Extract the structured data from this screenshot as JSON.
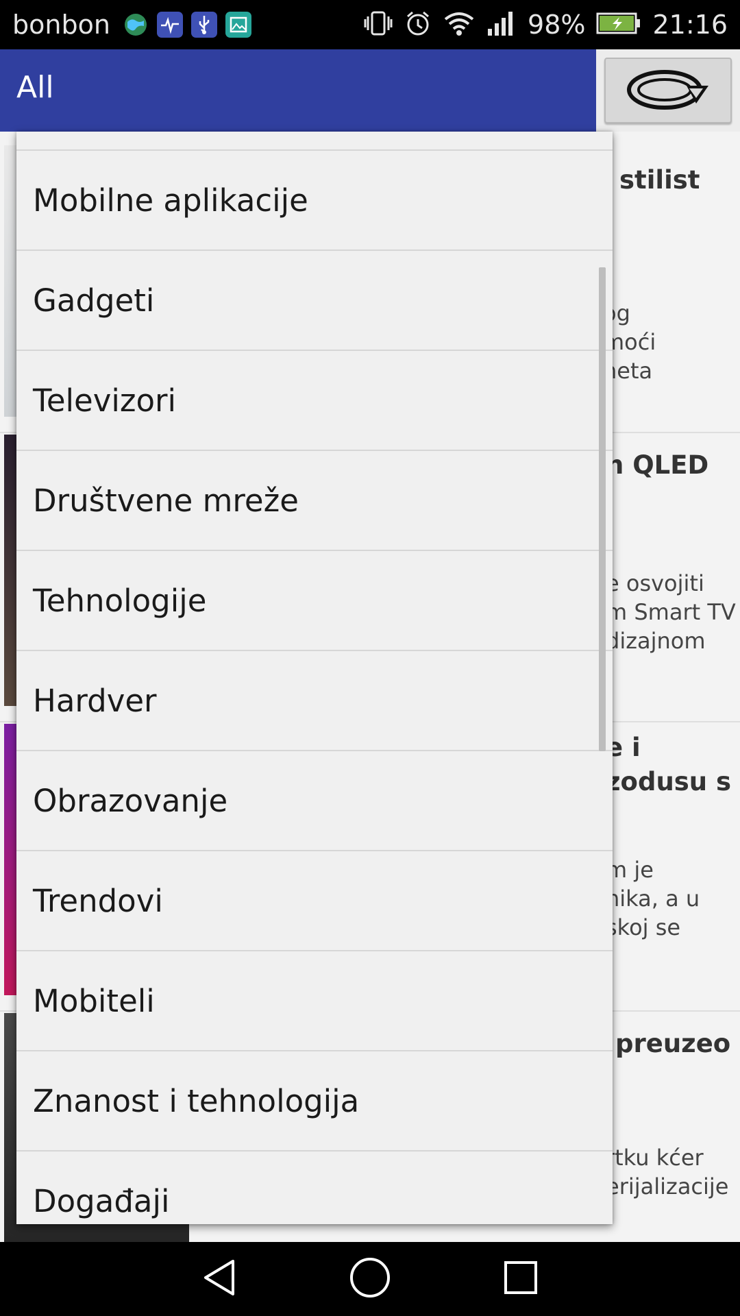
{
  "status_bar": {
    "carrier": "bonbon",
    "notification_icons": [
      "globe-icon",
      "health-icon",
      "usb-icon",
      "gallery-icon"
    ],
    "system_icons": [
      "vibrate-icon",
      "alarm-icon",
      "wifi-icon",
      "signal-icon"
    ],
    "battery_percent": "98%",
    "time": "21:16"
  },
  "app_bar": {
    "title": "All",
    "refresh_icon": "refresh-icon"
  },
  "dropdown": {
    "items": [
      {
        "label": "Mobilne aplikacije"
      },
      {
        "label": "Gadgeti"
      },
      {
        "label": "Televizori"
      },
      {
        "label": "Društvene mreže"
      },
      {
        "label": "Tehnologije"
      },
      {
        "label": "Hardver"
      },
      {
        "label": "Obrazovanje"
      },
      {
        "label": "Trendovi"
      },
      {
        "label": "Mobiteli"
      },
      {
        "label": "Znanost i tehnologija"
      },
      {
        "label": "Događaji"
      }
    ]
  },
  "background_articles": [
    {
      "title_lines": [
        "stilist"
      ],
      "snippet_lines": [
        "og",
        "moći",
        "neta"
      ]
    },
    {
      "title_lines": [
        "h QLED"
      ],
      "snippet_lines": [
        "e osvojiti",
        "m Smart TV",
        "dizajnom"
      ]
    },
    {
      "title_lines": [
        "e i",
        "zodusu s"
      ],
      "snippet_lines": [
        "m je",
        "nika, a u",
        "skoj se"
      ]
    },
    {
      "title_lines": [
        "preuzeo"
      ],
      "snippet_lines": [
        "rtku kćer",
        "erijalizacije"
      ]
    }
  ],
  "nav_bar": {
    "back_icon": "back-icon",
    "home_icon": "home-icon",
    "recents_icon": "recents-icon"
  }
}
